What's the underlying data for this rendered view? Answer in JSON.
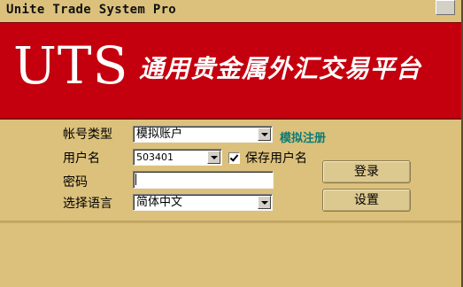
{
  "window": {
    "title": "Unite Trade System Pro"
  },
  "banner": {
    "logo": "UTS",
    "slogan": "通用贵金属外汇交易平台"
  },
  "form": {
    "account_type": {
      "label": "帐号类型",
      "selected": "模拟账户",
      "register_link": "模拟注册"
    },
    "username": {
      "label": "用户名",
      "value": "503401",
      "save_checkbox_label": "保存用户名",
      "save_checked": true
    },
    "password": {
      "label": "密码",
      "value": ""
    },
    "language": {
      "label": "选择语言",
      "selected": "简体中文"
    }
  },
  "buttons": {
    "login": "登录",
    "settings": "设置"
  },
  "colors": {
    "background": "#dcc17c",
    "banner": "#c4000e",
    "link": "#0b7a74"
  }
}
